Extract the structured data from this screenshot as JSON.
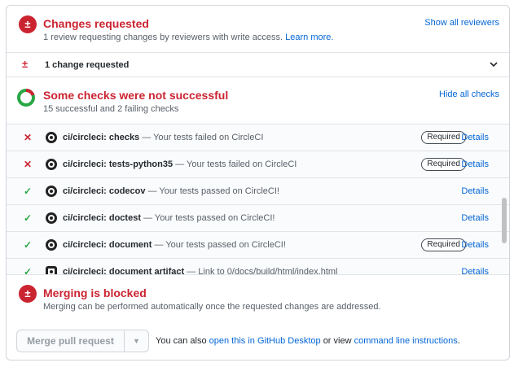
{
  "changes": {
    "icon": "plus-minus-icon",
    "title": "Changes requested",
    "subtitle": "1 review requesting changes by reviewers with write access.",
    "learn_more": "Learn more.",
    "show_reviewers": "Show all reviewers",
    "row_label": "1 change requested"
  },
  "checks": {
    "title": "Some checks were not successful",
    "subtitle": "15 successful and 2 failing checks",
    "hide_link": "Hide all checks",
    "details_label": "Details",
    "required_label": "Required",
    "items": [
      {
        "name": "ci/circleci: checks",
        "desc": "— Your tests failed on CircleCI",
        "status": "fail",
        "required": true
      },
      {
        "name": "ci/circleci: tests-python35",
        "desc": "— Your tests failed on CircleCI",
        "status": "fail",
        "required": true
      },
      {
        "name": "ci/circleci: codecov",
        "desc": "— Your tests passed on CircleCI!",
        "status": "pass",
        "required": false
      },
      {
        "name": "ci/circleci: doctest",
        "desc": "— Your tests passed on CircleCI!",
        "status": "pass",
        "required": false
      },
      {
        "name": "ci/circleci: document",
        "desc": "— Your tests passed on CircleCI!",
        "status": "pass",
        "required": true
      },
      {
        "name": "ci/circleci: document artifact",
        "desc": "— Link to 0/docs/build/html/index.html",
        "status": "pass",
        "required": false
      }
    ]
  },
  "merge": {
    "title": "Merging is blocked",
    "subtitle": "Merging can be performed automatically once the requested changes are addressed.",
    "button": "Merge pull request",
    "note_prefix": "You can also",
    "desktop_link": "open this in GitHub Desktop",
    "note_middle": "or view",
    "cli_link": "command line instructions",
    "note_suffix": "."
  },
  "colors": {
    "danger": "#cb2431",
    "success": "#28a745",
    "link": "#0366d6"
  }
}
